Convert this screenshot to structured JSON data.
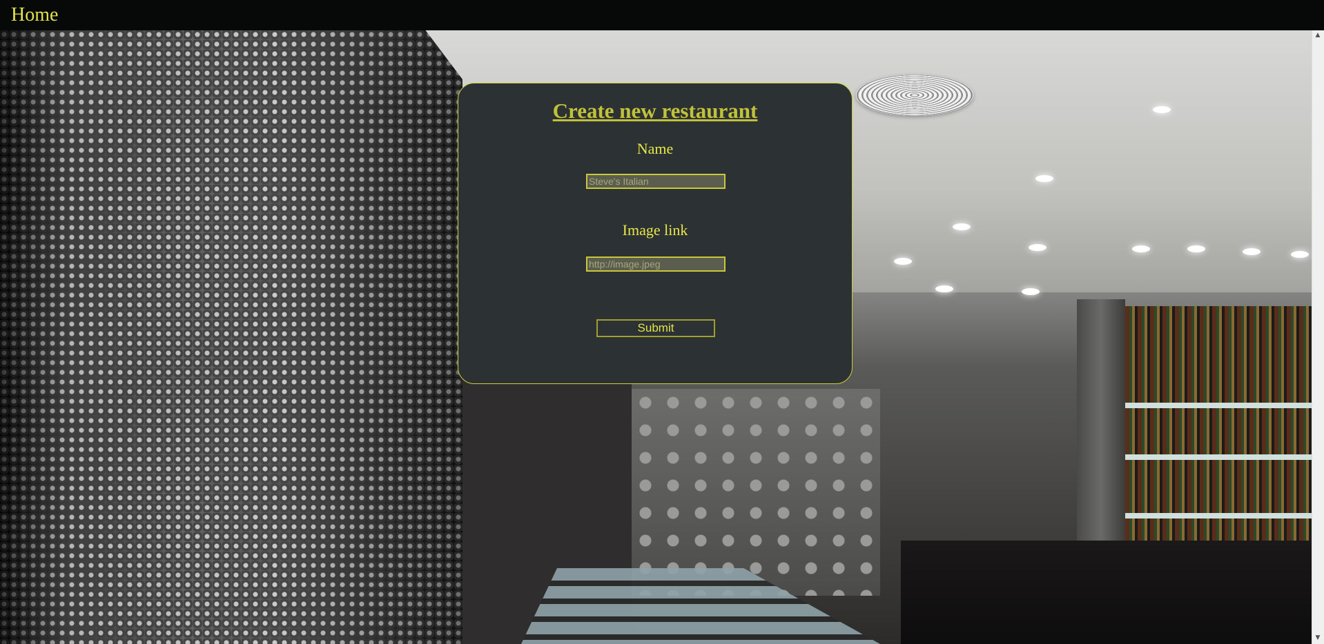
{
  "header": {
    "home_label": "Home"
  },
  "form": {
    "title": "Create new restaurant",
    "name_label": "Name",
    "name_placeholder": "Steve's Italian",
    "image_label": "Image link",
    "image_placeholder": "http://image.jpeg",
    "submit_label": "Submit"
  },
  "background": {
    "image_icon": "restaurant-interior-photo"
  },
  "colors": {
    "accent": "#e3e34a",
    "title": "#c2c23a",
    "card_background": "#2c3233",
    "topbar": "#070909"
  }
}
